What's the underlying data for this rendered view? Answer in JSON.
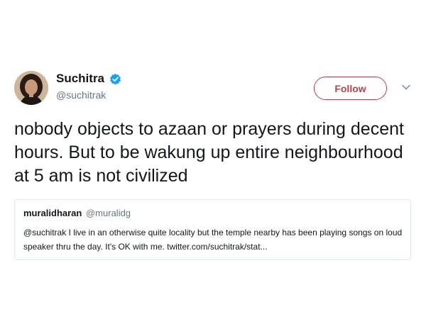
{
  "tweet": {
    "author": {
      "name": "Suchitra",
      "handle": "@suchitrak",
      "verified": true,
      "avatar_icon": "avatar-photo-icon"
    },
    "follow_label": "Follow",
    "menu_icon": "chevron-down-icon",
    "text": "nobody objects to azaan or prayers during decent hours. But to be wakung up entire neighbourhood at 5 am is not civilized",
    "quoted": {
      "name": "muralidharan",
      "handle": "@muralidg",
      "text": "@suchitrak I live in an otherwise quite locality but the temple nearby has been playing songs on loud speaker thru the day. It's OK with me. twitter.com/suchitrak/stat..."
    }
  },
  "colors": {
    "follow_accent": "#c03f4a",
    "verified_badge": "#1da1f2",
    "secondary_text": "#657786",
    "card_border": "#e1e8ed"
  }
}
